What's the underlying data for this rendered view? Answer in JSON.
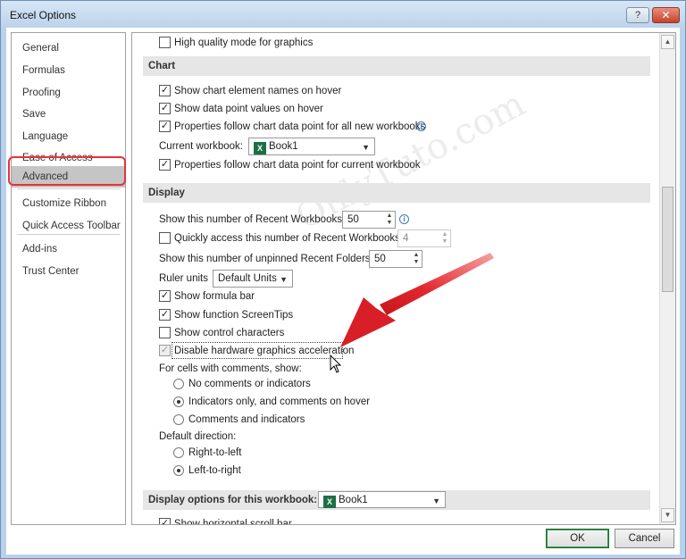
{
  "window": {
    "title": "Excel Options",
    "help_label": "?",
    "close_label": "✕"
  },
  "nav": {
    "items": [
      {
        "label": "General"
      },
      {
        "label": "Formulas"
      },
      {
        "label": "Proofing"
      },
      {
        "label": "Save"
      },
      {
        "label": "Language"
      },
      {
        "label": "Ease of Access"
      },
      {
        "label": "Advanced",
        "active": true
      },
      {
        "label": "Customize Ribbon"
      },
      {
        "label": "Quick Access Toolbar"
      },
      {
        "label": "Add-ins"
      },
      {
        "label": "Trust Center"
      }
    ]
  },
  "options": {
    "high_quality": {
      "label": "High quality mode for graphics",
      "checked": false
    },
    "chart_section": "Chart",
    "chart_names": {
      "label": "Show chart element names on hover",
      "checked": true
    },
    "chart_values": {
      "label": "Show data point values on hover",
      "checked": true
    },
    "chart_props_all": {
      "label": "Properties follow chart data point for all new workbooks",
      "checked": true
    },
    "current_workbook_label": "Current workbook:",
    "current_workbook_value": "Book1",
    "chart_props_current": {
      "label": "Properties follow chart data point for current workbook",
      "checked": true
    },
    "display_section": "Display",
    "recent_workbooks_label": "Show this number of Recent Workbooks:",
    "recent_workbooks_value": "50",
    "quick_access": {
      "label": "Quickly access this number of Recent Workbooks:",
      "checked": false,
      "value": "4"
    },
    "unpinned_folders_label": "Show this number of unpinned Recent Folders:",
    "unpinned_folders_value": "50",
    "ruler_units_label": "Ruler units",
    "ruler_units_value": "Default Units",
    "formula_bar": {
      "label": "Show formula bar",
      "checked": true
    },
    "function_tips": {
      "label": "Show function ScreenTips",
      "checked": true
    },
    "control_chars": {
      "label": "Show control characters",
      "checked": false
    },
    "hw_accel": {
      "label": "Disable hardware graphics acceleration",
      "checked": true
    },
    "comments_label": "For cells with comments, show:",
    "comments_options": [
      {
        "label": "No comments or indicators",
        "selected": false
      },
      {
        "label": "Indicators only, and comments on hover",
        "selected": true
      },
      {
        "label": "Comments and indicators",
        "selected": false
      }
    ],
    "direction_label": "Default direction:",
    "direction_options": [
      {
        "label": "Right-to-left",
        "selected": false
      },
      {
        "label": "Left-to-right",
        "selected": true
      }
    ],
    "workbook_section": "Display options for this workbook:",
    "workbook_select_value": "Book1",
    "horizontal_scroll": {
      "label": "Show horizontal scroll bar",
      "checked": true
    }
  },
  "buttons": {
    "ok": "OK",
    "cancel": "Cancel"
  },
  "icons": {
    "excel": "X",
    "info": "i",
    "check": "✓"
  },
  "watermark": "OnlyTuto.com",
  "colors": {
    "highlight": "#e8323a",
    "arrow": "#e2272e",
    "excel_green": "#1d7044"
  }
}
